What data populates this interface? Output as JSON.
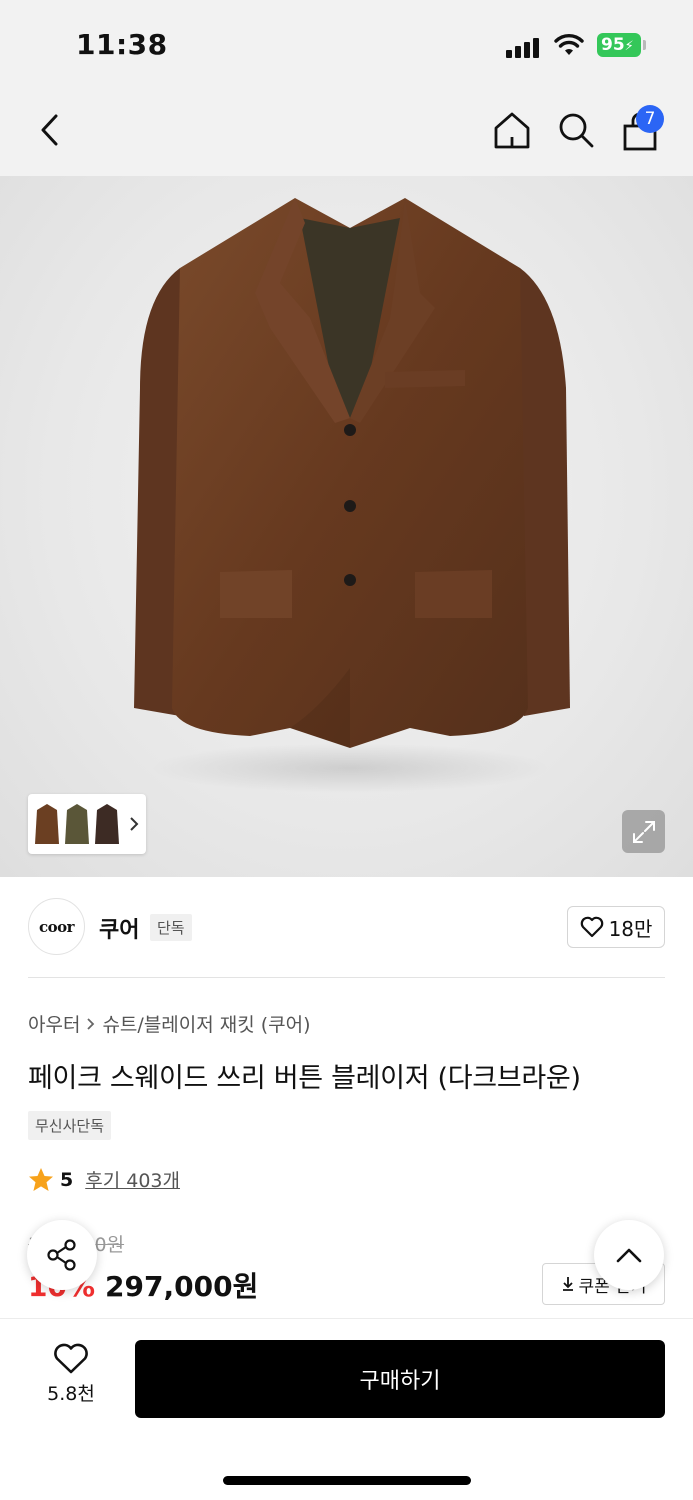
{
  "status_bar": {
    "time": "11:38",
    "battery": "95"
  },
  "nav": {
    "cart_count": "7"
  },
  "brand": {
    "logo_text": "coor",
    "name": "쿠어",
    "tag": "단독",
    "likes": "18만"
  },
  "breadcrumb": {
    "level1": "아우터",
    "level2": "슈트/블레이저 재킷 (쿠어)"
  },
  "product": {
    "title": "페이크 스웨이드 쓰리 버튼 블레이저 (다크브라운)",
    "exclusive_tag": "무신사단독"
  },
  "rating": {
    "score": "5",
    "reviews": "후기 403개"
  },
  "pricing": {
    "original_price": "330,000원",
    "discount": "10%",
    "price": "297,000원",
    "coupon_label": "쿠폰 받기"
  },
  "bottom_bar": {
    "wish_count": "5.8천",
    "buy_label": "구매하기"
  },
  "colors": {
    "accent_blue": "#2b65f5",
    "discount_red": "#ef2f2f",
    "battery_green": "#34c759",
    "jacket_brown": "#6b3f22"
  },
  "icons": [
    "back-icon",
    "home-icon",
    "search-icon",
    "bag-icon",
    "expand-icon",
    "heart-icon",
    "star-icon",
    "share-icon",
    "chevron-up-icon",
    "download-icon"
  ]
}
